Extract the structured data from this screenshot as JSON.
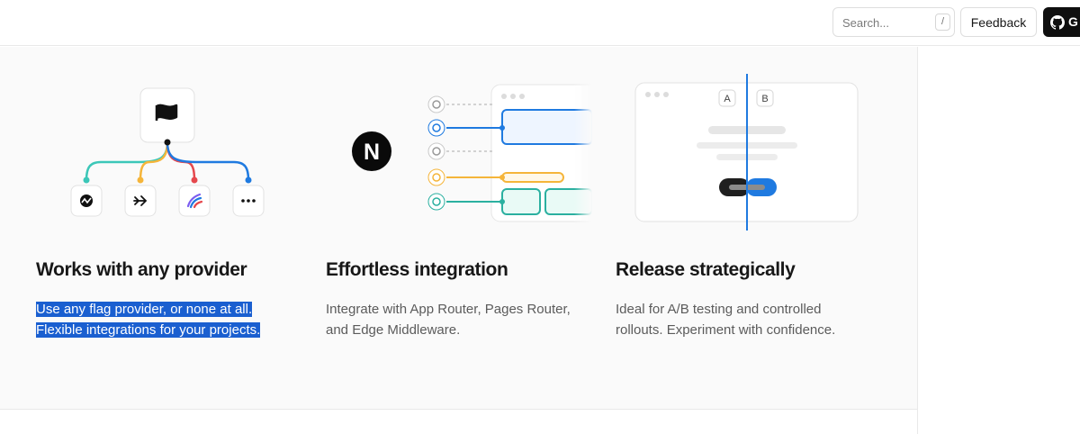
{
  "header": {
    "search_placeholder": "Search...",
    "search_shortcut": "/",
    "feedback_label": "Feedback",
    "github_label": "G"
  },
  "features": [
    {
      "title": "Works with any provider",
      "desc_line1": "Use any flag provider, or none at all.",
      "desc_line2": "Flexible integrations for your projects.",
      "icons": [
        "flag-icon",
        "provider-logo-icon",
        "arrow-logo-icon",
        "gradient-logo-icon",
        "more-icon"
      ]
    },
    {
      "title": "Effortless integration",
      "desc_line1": "Integrate with App Router, Pages Router,",
      "desc_line2": "and Edge Middleware.",
      "logo_letter": "N"
    },
    {
      "title": "Release strategically",
      "desc_line1": "Ideal for A/B testing and controlled",
      "desc_line2": "rollouts. Experiment with confidence.",
      "variant_a": "A",
      "variant_b": "B"
    }
  ],
  "colors": {
    "teal": "#3cc7b8",
    "yellow": "#f5b53a",
    "red": "#e5484d",
    "blue": "#1f7ae0",
    "selection": "#1a5fd0"
  }
}
